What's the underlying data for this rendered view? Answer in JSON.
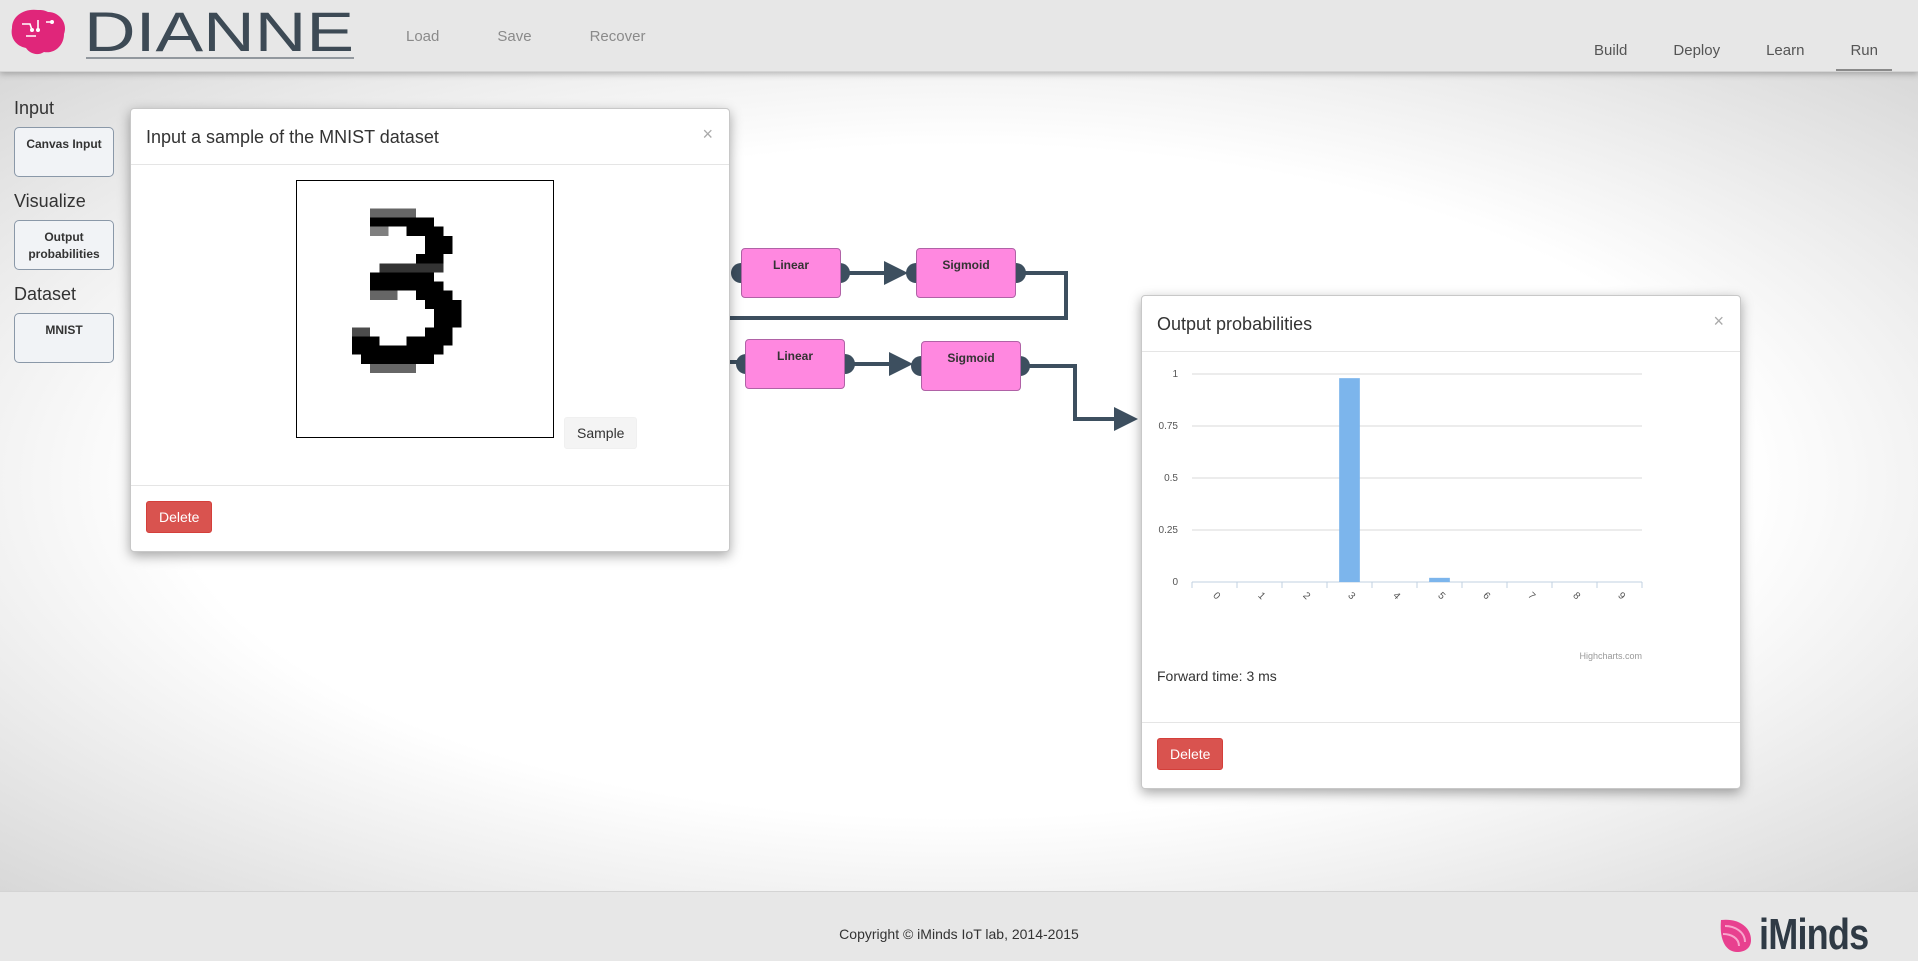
{
  "app": {
    "brand": "DIANNE"
  },
  "nav": {
    "left": [
      {
        "label": "Load"
      },
      {
        "label": "Save"
      },
      {
        "label": "Recover"
      }
    ],
    "right": [
      {
        "label": "Build"
      },
      {
        "label": "Deploy"
      },
      {
        "label": "Learn"
      },
      {
        "label": "Run",
        "active": true
      }
    ]
  },
  "toolbox": {
    "categories": [
      {
        "name": "Input",
        "items": [
          "Canvas Input"
        ]
      },
      {
        "name": "Visualize",
        "items": [
          "Output probabilities"
        ]
      },
      {
        "name": "Dataset",
        "items": [
          "MNIST"
        ]
      }
    ]
  },
  "blocks": [
    {
      "label": "Linear"
    },
    {
      "label": "Sigmoid"
    },
    {
      "label": "Linear"
    },
    {
      "label": "Sigmoid"
    }
  ],
  "input_dialog": {
    "title": "Input a sample of the MNIST dataset",
    "close": "×",
    "sample_label": "Sample",
    "delete_label": "Delete"
  },
  "output_dialog": {
    "title": "Output probabilities",
    "close": "×",
    "forward_time": "Forward time: 3 ms",
    "credits": "Highcharts.com",
    "delete_label": "Delete"
  },
  "chart_data": {
    "type": "bar",
    "categories": [
      "0",
      "1",
      "2",
      "3",
      "4",
      "5",
      "6",
      "7",
      "8",
      "9"
    ],
    "values": [
      0.0,
      0.0,
      0.0,
      0.98,
      0.0,
      0.02,
      0.0,
      0.0,
      0.0,
      0.0
    ],
    "ylim": [
      0,
      1
    ],
    "yticks": [
      "0",
      "0.25",
      "0.5",
      "0.75",
      "1"
    ],
    "grid": true,
    "color": "#7cb5ec"
  },
  "footer": {
    "copyright": "Copyright © iMinds IoT lab, 2014-2015",
    "logo_text": "iMinds"
  },
  "colors": {
    "block": "#ff88e0",
    "wire": "#3d4f5f",
    "delete": "#d9534f"
  }
}
